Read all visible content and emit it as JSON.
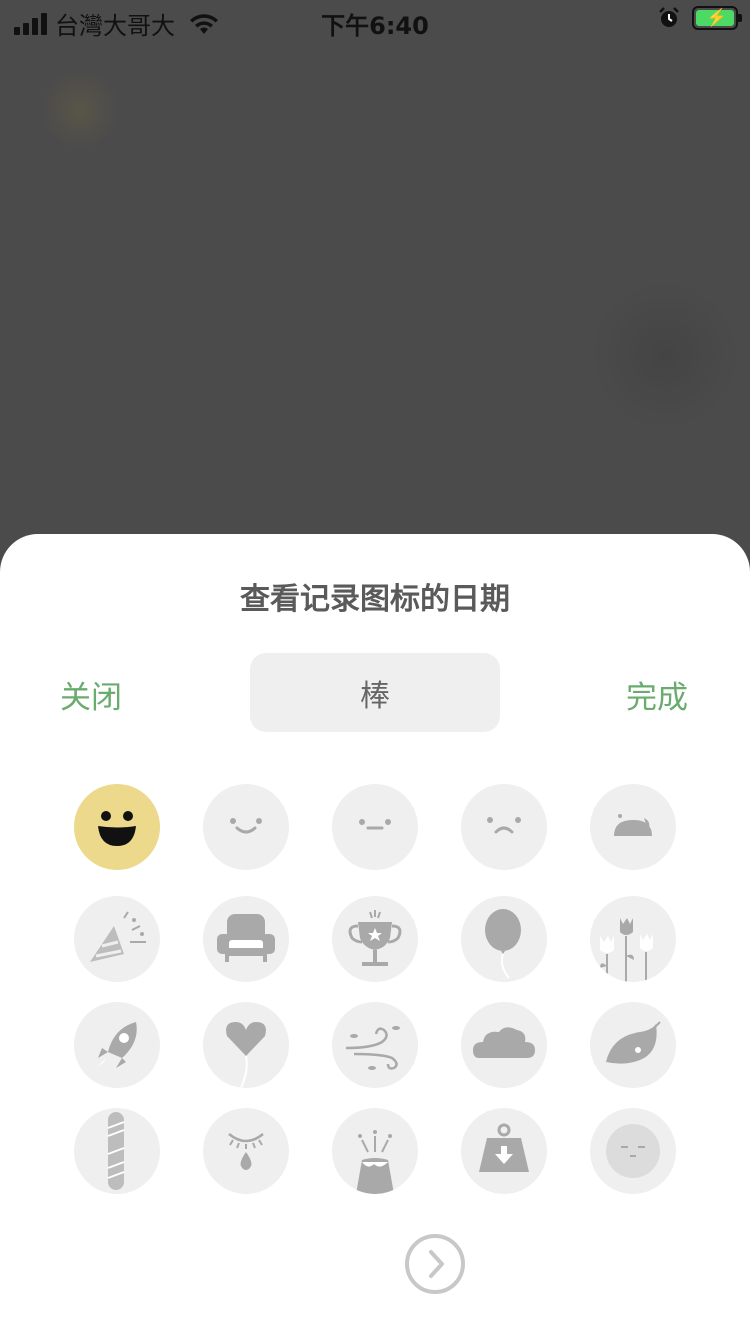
{
  "status_bar": {
    "carrier": "台灣大哥大",
    "time": "下午6:40"
  },
  "sheet": {
    "title": "查看记录图标的日期",
    "close_label": "关闭",
    "done_label": "完成",
    "selected_label": "棒"
  },
  "colors": {
    "accent": "#6aab6e",
    "selected_icon": "#ecd98c",
    "icon_bg": "#efefef",
    "icon_fg": "#a9a9a9"
  },
  "icons": [
    "grin-face-icon",
    "smile-face-icon",
    "neutral-face-icon",
    "frown-face-icon",
    "crying-face-icon",
    "party-popper-icon",
    "armchair-icon",
    "trophy-icon",
    "balloon-icon",
    "tulips-icon",
    "rocket-icon",
    "heart-balloon-icon",
    "wind-icon",
    "cloud-icon",
    "leaf-icon",
    "bandage-icon",
    "sleepy-eye-icon",
    "volcano-icon",
    "weight-icon",
    "sleepy-face-icon"
  ],
  "selected_icon_index": 0
}
